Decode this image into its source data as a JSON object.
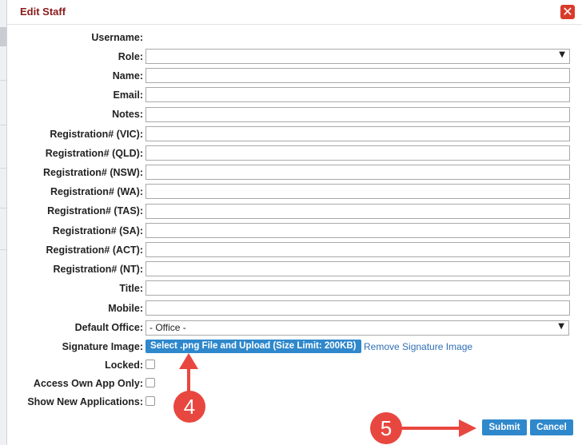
{
  "dialog": {
    "title": "Edit Staff",
    "close_glyph": "✕"
  },
  "form": {
    "username_label": "Username:",
    "role_label": "Role:",
    "role_value": "",
    "name_label": "Name:",
    "email_label": "Email:",
    "notes_label": "Notes:",
    "reg_vic_label": "Registration# (VIC):",
    "reg_qld_label": "Registration# (QLD):",
    "reg_nsw_label": "Registration# (NSW):",
    "reg_wa_label": "Registration# (WA):",
    "reg_tas_label": "Registration# (TAS):",
    "reg_sa_label": "Registration# (SA):",
    "reg_act_label": "Registration# (ACT):",
    "reg_nt_label": "Registration# (NT):",
    "title_label": "Title:",
    "mobile_label": "Mobile:",
    "office_label": "Default Office:",
    "office_value": "- Office -",
    "signature_label": "Signature Image:",
    "upload_button": "Select .png File and Upload (Size Limit: 200KB)",
    "remove_link": "Remove Signature Image",
    "locked_label": "Locked:",
    "access_label": "Access Own App Only:",
    "show_new_label": "Show New Applications:"
  },
  "actions": {
    "submit": "Submit",
    "cancel": "Cancel"
  },
  "annotations": {
    "badge_4": "4",
    "badge_5": "5",
    "color": "#e8473f"
  },
  "colors": {
    "title": "#8b1a1a",
    "button": "#2f88cc",
    "link": "#2f6fb6"
  }
}
